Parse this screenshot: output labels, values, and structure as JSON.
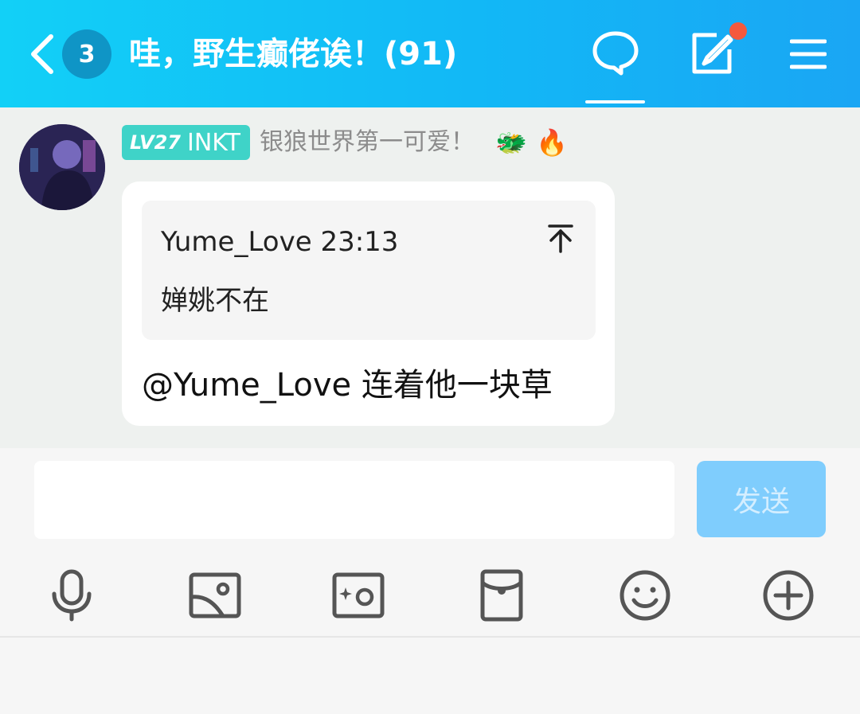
{
  "header": {
    "unread_count": "3",
    "title": "哇，野生癫佬诶！(91)"
  },
  "post": {
    "level": {
      "lv": "LV27",
      "name": "INKT"
    },
    "nickname": "银狼世界第一可爱！",
    "emojis": [
      "🐲",
      "🔥"
    ],
    "quote": {
      "user_time": "Yume_Love 23:13",
      "text": "婵姚不在"
    },
    "message": "@Yume_Love 连着他一块草"
  },
  "composer": {
    "placeholder": "",
    "send_label": "发送"
  },
  "toolbar": {
    "icons": [
      "microphone-icon",
      "image-icon",
      "camera-icon",
      "red-envelope-icon",
      "emoji-icon",
      "plus-icon"
    ]
  },
  "colors": {
    "header_start": "#12d0f7",
    "header_end": "#1aa6f4",
    "level_badge": "#3fd3c8",
    "send_button": "#7fcdfd",
    "notification_dot": "#f4593d"
  }
}
